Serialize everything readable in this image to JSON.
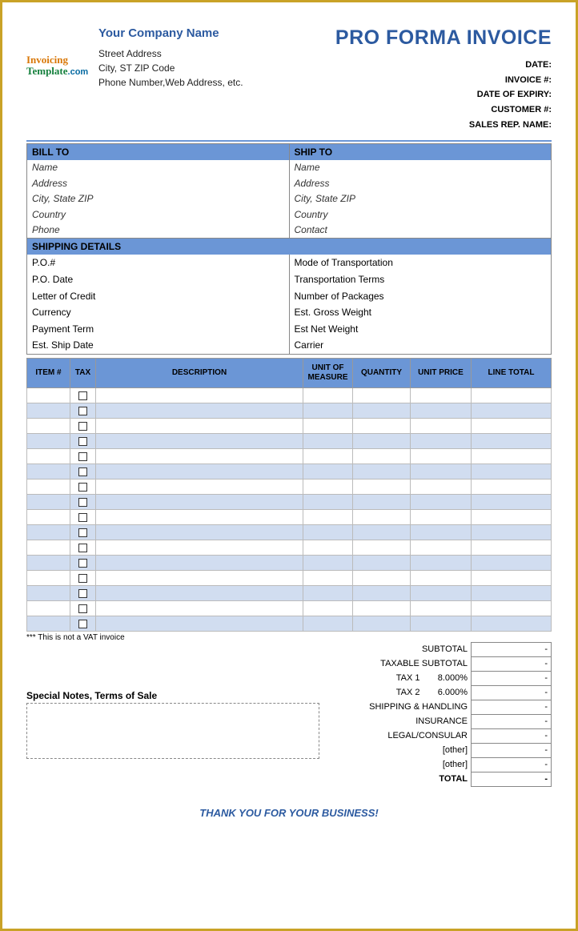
{
  "header": {
    "logo": {
      "line1": "Invoicing",
      "line2": "Template",
      "line3": ".com"
    },
    "company_name": "Your Company Name",
    "street": "Street Address",
    "city": "City, ST  ZIP Code",
    "contact": "Phone Number,Web Address, etc.",
    "title": "PRO FORMA INVOICE",
    "meta": {
      "date": "DATE:",
      "invoice_no": "INVOICE #:",
      "expiry": "DATE OF EXPIRY:",
      "customer_no": "CUSTOMER #:",
      "sales_rep": "SALES REP. NAME:"
    }
  },
  "bill_to": {
    "header": "BILL TO",
    "name": "Name",
    "address": "Address",
    "city": "City, State ZIP",
    "country": "Country",
    "phone": "Phone"
  },
  "ship_to": {
    "header": "SHIP TO",
    "name": "Name",
    "address": "Address",
    "city": "City, State ZIP",
    "country": "Country",
    "contact": "Contact"
  },
  "shipping": {
    "header": "SHIPPING DETAILS",
    "left": [
      "P.O.#",
      "P.O. Date",
      "Letter of Credit",
      "Currency",
      "Payment Term",
      "Est. Ship Date"
    ],
    "right": [
      "Mode of Transportation",
      "Transportation Terms",
      "Number of Packages",
      "Est. Gross Weight",
      "Est Net Weight",
      "Carrier"
    ]
  },
  "items": {
    "headers": {
      "item": "ITEM #",
      "tax": "TAX",
      "desc": "DESCRIPTION",
      "uom": "UNIT OF MEASURE",
      "qty": "QUANTITY",
      "price": "UNIT PRICE",
      "total": "LINE TOTAL"
    },
    "row_count": 16
  },
  "vat_note": "*** This is not a VAT invoice",
  "notes_label": "Special Notes, Terms of Sale",
  "totals": {
    "subtotal": {
      "label": "SUBTOTAL",
      "value": "-"
    },
    "taxable": {
      "label": "TAXABLE SUBTOTAL",
      "value": "-"
    },
    "tax1": {
      "label": "TAX 1",
      "pct": "8.000%",
      "value": "-"
    },
    "tax2": {
      "label": "TAX 2",
      "pct": "6.000%",
      "value": "-"
    },
    "shipping": {
      "label": "SHIPPING & HANDLING",
      "value": "-"
    },
    "insurance": {
      "label": "INSURANCE",
      "value": "-"
    },
    "legal": {
      "label": "LEGAL/CONSULAR",
      "value": "-"
    },
    "other1": {
      "label": "[other]",
      "value": "-"
    },
    "other2": {
      "label": "[other]",
      "value": "-"
    },
    "total": {
      "label": "TOTAL",
      "value": "-"
    }
  },
  "thanks": "THANK YOU FOR YOUR BUSINESS!"
}
